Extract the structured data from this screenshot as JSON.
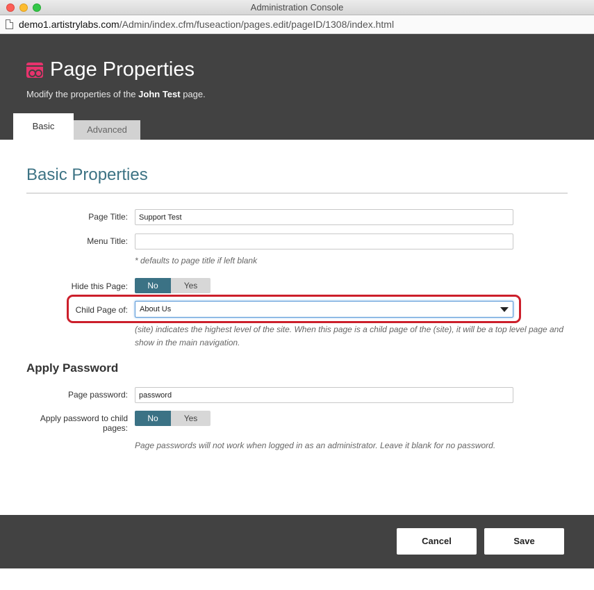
{
  "window": {
    "title": "Administration Console"
  },
  "url": {
    "host": "demo1.artistrylabs.com",
    "path": "/Admin/index.cfm/fuseaction/pages.edit/pageID/1308/index.html"
  },
  "header": {
    "title": "Page Properties",
    "subtitle_prefix": "Modify the properties of the ",
    "subtitle_page": "John Test",
    "subtitle_suffix": " page.",
    "tabs": [
      {
        "label": "Basic",
        "active": true
      },
      {
        "label": "Advanced",
        "active": false
      }
    ]
  },
  "basic": {
    "section_title": "Basic Properties",
    "page_title_label": "Page Title:",
    "page_title_value": "Support Test",
    "menu_title_label": "Menu Title:",
    "menu_title_value": "",
    "menu_title_hint": "* defaults to page title if left blank",
    "hide_page_label": "Hide this Page:",
    "hide_page_no": "No",
    "hide_page_yes": "Yes",
    "hide_page_selected": "No",
    "child_page_label": "Child Page of:",
    "child_page_value": "About Us",
    "child_page_hint": "(site) indicates the highest level of the site. When this page is a child page of the (site), it will be a top level page and show in the main navigation."
  },
  "password": {
    "section_title": "Apply Password",
    "page_password_label": "Page password:",
    "page_password_value": "password",
    "apply_child_label": "Apply password to child pages:",
    "apply_child_no": "No",
    "apply_child_yes": "Yes",
    "apply_child_selected": "No",
    "hint": "Page passwords will not work when logged in as an administrator. Leave it blank for no password."
  },
  "footer": {
    "cancel_label": "Cancel",
    "save_label": "Save"
  },
  "colors": {
    "header_bg": "#424242",
    "accent_teal": "#3b7285",
    "logo_pink": "#e8336d",
    "highlight_red": "#cc1f2b"
  }
}
